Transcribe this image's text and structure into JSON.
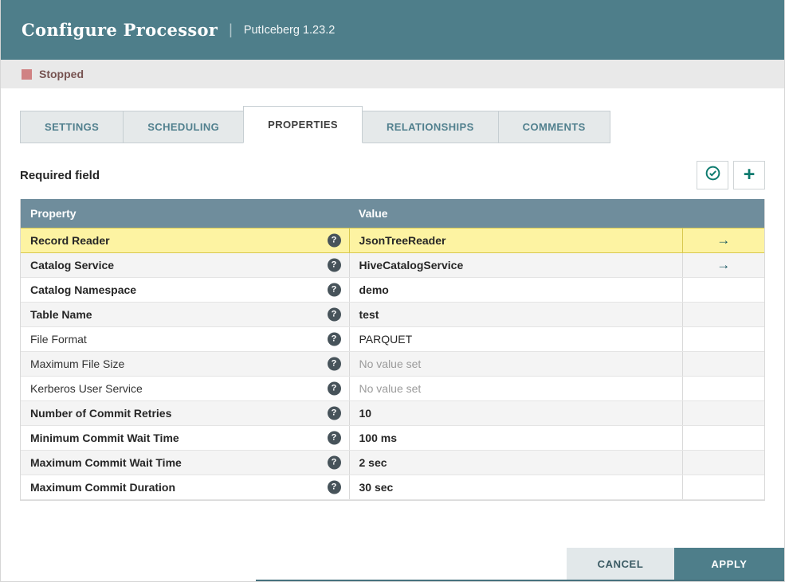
{
  "header": {
    "title": "Configure Processor",
    "separator": "|",
    "subtitle": "PutIceberg 1.23.2"
  },
  "status": {
    "label": "Stopped"
  },
  "tabs": [
    {
      "label": "SETTINGS",
      "active": false
    },
    {
      "label": "SCHEDULING",
      "active": false
    },
    {
      "label": "PROPERTIES",
      "active": true
    },
    {
      "label": "RELATIONSHIPS",
      "active": false
    },
    {
      "label": "COMMENTS",
      "active": false
    }
  ],
  "toolbar": {
    "required_label": "Required field",
    "verify_button": "verify-properties",
    "add_button": "add-property"
  },
  "icons": {
    "help": "?",
    "go_to": "→",
    "add": "+",
    "verify": "checkmark-circle"
  },
  "table": {
    "columns": [
      "Property",
      "Value"
    ],
    "rows": [
      {
        "property": "Record Reader",
        "value": "JsonTreeReader",
        "required": true,
        "selected": true,
        "has_goto": true,
        "value_set": true,
        "value_bold": true
      },
      {
        "property": "Catalog Service",
        "value": "HiveCatalogService",
        "required": true,
        "selected": false,
        "has_goto": true,
        "value_set": true,
        "value_bold": true
      },
      {
        "property": "Catalog Namespace",
        "value": "demo",
        "required": true,
        "selected": false,
        "has_goto": false,
        "value_set": true,
        "value_bold": true
      },
      {
        "property": "Table Name",
        "value": "test",
        "required": true,
        "selected": false,
        "has_goto": false,
        "value_set": true,
        "value_bold": true
      },
      {
        "property": "File Format",
        "value": "PARQUET",
        "required": false,
        "selected": false,
        "has_goto": false,
        "value_set": true,
        "value_bold": false
      },
      {
        "property": "Maximum File Size",
        "value": "No value set",
        "required": false,
        "selected": false,
        "has_goto": false,
        "value_set": false,
        "value_bold": false
      },
      {
        "property": "Kerberos User Service",
        "value": "No value set",
        "required": false,
        "selected": false,
        "has_goto": false,
        "value_set": false,
        "value_bold": false
      },
      {
        "property": "Number of Commit Retries",
        "value": "10",
        "required": true,
        "selected": false,
        "has_goto": false,
        "value_set": true,
        "value_bold": true
      },
      {
        "property": "Minimum Commit Wait Time",
        "value": "100 ms",
        "required": true,
        "selected": false,
        "has_goto": false,
        "value_set": true,
        "value_bold": true
      },
      {
        "property": "Maximum Commit Wait Time",
        "value": "2 sec",
        "required": true,
        "selected": false,
        "has_goto": false,
        "value_set": true,
        "value_bold": true
      },
      {
        "property": "Maximum Commit Duration",
        "value": "30 sec",
        "required": true,
        "selected": false,
        "has_goto": false,
        "value_set": true,
        "value_bold": true
      }
    ]
  },
  "footer": {
    "cancel_label": "CANCEL",
    "apply_label": "APPLY"
  },
  "colors": {
    "header_bg": "#4e7e8a",
    "table_header_bg": "#6f8d9c",
    "accent_teal": "#0c7a6e",
    "selected_row_bg": "#fdf3a2",
    "selected_row_border": "#d8c84e",
    "stopped_red": "#d08283",
    "stopped_text": "#775351"
  }
}
